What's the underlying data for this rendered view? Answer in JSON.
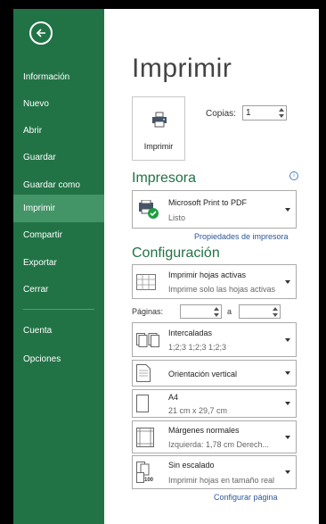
{
  "sidebar": {
    "back_icon": "back-arrow-icon",
    "items": [
      {
        "label": "Información"
      },
      {
        "label": "Nuevo"
      },
      {
        "label": "Abrir"
      },
      {
        "label": "Guardar"
      },
      {
        "label": "Guardar como"
      },
      {
        "label": "Imprimir"
      },
      {
        "label": "Compartir"
      },
      {
        "label": "Exportar"
      },
      {
        "label": "Cerrar"
      },
      {
        "label": "Cuenta"
      },
      {
        "label": "Opciones"
      }
    ],
    "active": "Imprimir",
    "colors": {
      "bg": "#217346",
      "active": "#439467"
    }
  },
  "main": {
    "title": "Imprimir",
    "print_button": {
      "label": "Imprimir",
      "icon": "printer-icon"
    },
    "copies": {
      "label": "Copias:",
      "value": "1"
    },
    "printer": {
      "heading": "Impresora",
      "info_icon": "info-icon",
      "name": "Microsoft Print to PDF",
      "status": "Listo",
      "properties_link": "Propiedades de impresora"
    },
    "settings": {
      "heading": "Configuración",
      "what": {
        "title": "Imprimir hojas activas",
        "subtitle": "Imprime solo las hojas activas"
      },
      "pages": {
        "label": "Páginas:",
        "to": "a",
        "from_value": "",
        "to_value": ""
      },
      "collation": {
        "title": "Intercaladas",
        "subtitle": "1;2;3   1;2;3   1;2;3"
      },
      "orientation": {
        "title": "Orientación vertical"
      },
      "paper": {
        "title": "A4",
        "subtitle": "21 cm x 29,7 cm"
      },
      "margins": {
        "title": "Márgenes normales",
        "subtitle": "Izquierda:  1,78 cm    Derech..."
      },
      "scaling": {
        "title": "Sin escalado",
        "subtitle": "Imprimir hojas en tamaño real",
        "icon_text": "100"
      },
      "page_setup_link": "Configurar página"
    },
    "accent_color": "#217346"
  }
}
